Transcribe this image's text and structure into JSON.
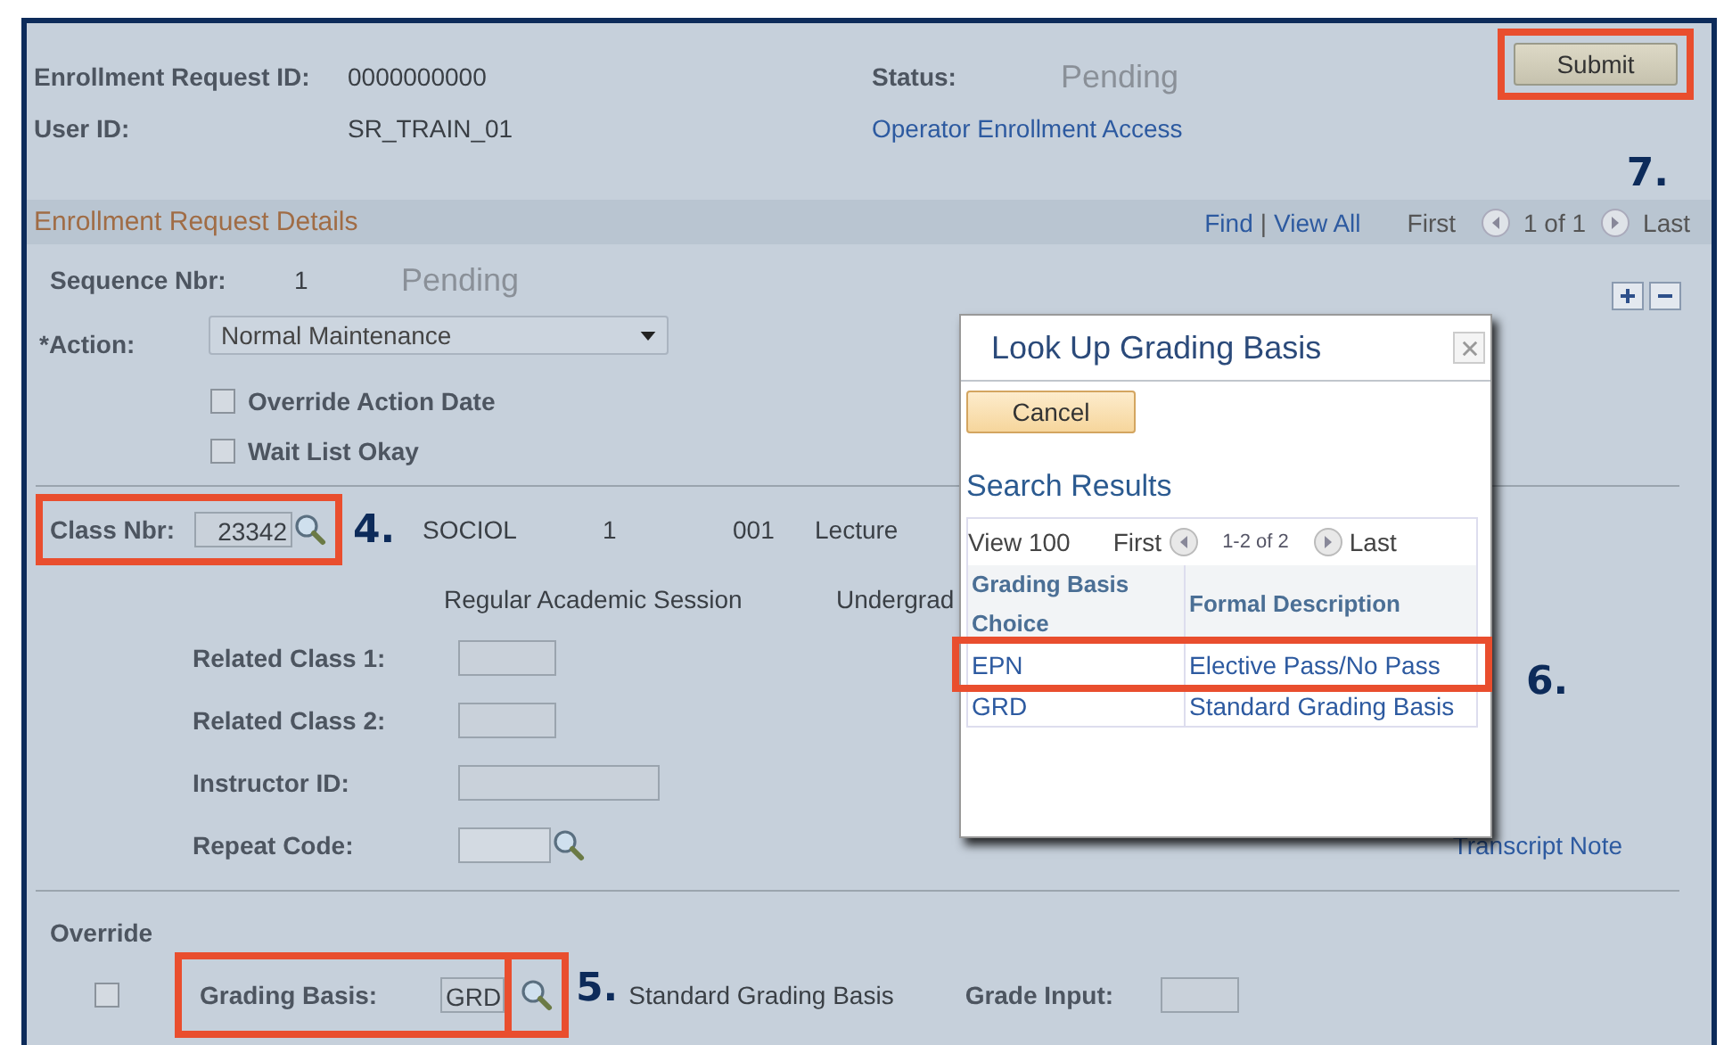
{
  "header": {
    "fields": [
      {
        "label": "Enrollment Request ID:",
        "value": "0000000000"
      },
      {
        "label": "User ID:",
        "value": "SR_TRAIN_01"
      }
    ],
    "status": {
      "label": "Status:",
      "value": "Pending"
    },
    "link": "Operator Enrollment Access",
    "submit": {
      "label": "Submit",
      "highlighted": true
    },
    "callout": "7."
  },
  "section": {
    "title": "Enrollment Request Details",
    "nav": {
      "find": "Find",
      "separator": "|",
      "view_all": "View All",
      "first": "First",
      "count": "1 of 1",
      "last": "Last"
    }
  },
  "sequence": {
    "label": "Sequence Nbr:",
    "value": "1",
    "status": "Pending"
  },
  "action": {
    "label": "*Action:",
    "value": "Normal Maintenance"
  },
  "options": [
    {
      "label": "Override Action Date",
      "checked": false
    },
    {
      "label": "Wait List Okay",
      "checked": false
    }
  ],
  "class": {
    "label": "Class Nbr:",
    "value": "23342",
    "highlighted": true,
    "callout": "4.",
    "details": [
      "SOCIOL",
      "1",
      "001",
      "Lecture"
    ],
    "session": "Regular Academic Session",
    "career": "Undergrad"
  },
  "related": [
    {
      "label": "Related Class 1:",
      "kind": "short"
    },
    {
      "label": "Related Class 2:",
      "kind": "short"
    },
    {
      "label": "Instructor ID:",
      "kind": "wide"
    },
    {
      "label": "Repeat Code:",
      "kind": "lookup"
    }
  ],
  "transcript_link": "Transcript Note",
  "override": {
    "label": "Override",
    "checked": false
  },
  "grading": {
    "label": "Grading Basis:",
    "value": "GRD",
    "description": "Standard Grading Basis",
    "highlighted": true,
    "callout": "5.",
    "grade_input_label": "Grade Input:"
  },
  "lookup": {
    "title": "Look Up Grading Basis",
    "cancel": "Cancel",
    "results_title": "Search Results",
    "nav": {
      "view": "View 100",
      "first": "First",
      "count": "1-2 of 2",
      "last": "Last"
    },
    "columns": [
      "Grading Basis Choice",
      "Formal Description"
    ],
    "rows": [
      {
        "code": "EPN",
        "description": "Elective Pass/No Pass",
        "highlighted": true
      },
      {
        "code": "GRD",
        "description": "Standard Grading Basis",
        "highlighted": false
      }
    ],
    "callout": "6."
  }
}
